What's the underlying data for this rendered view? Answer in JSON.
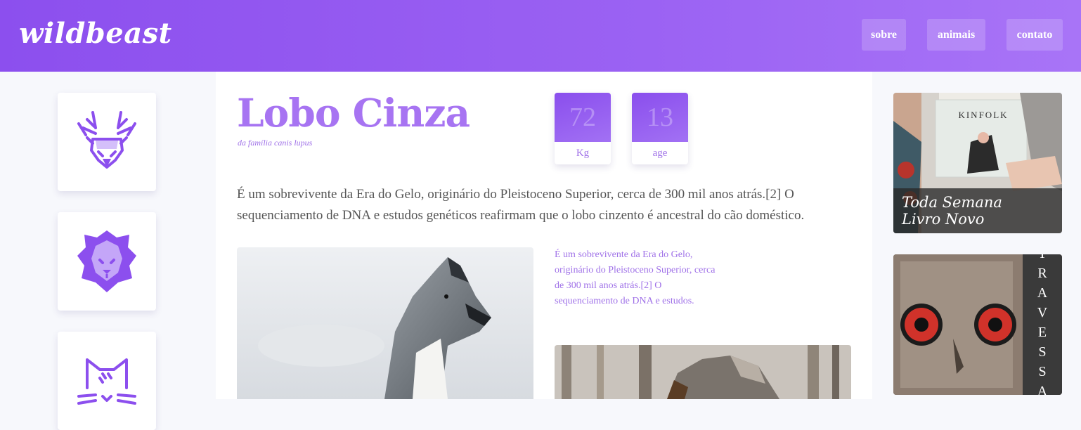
{
  "header": {
    "logo": "wildbeast",
    "nav": [
      {
        "label": "sobre"
      },
      {
        "label": "animais"
      },
      {
        "label": "contato"
      }
    ]
  },
  "sidebar": {
    "animals": [
      {
        "icon": "deer-icon"
      },
      {
        "icon": "lion-icon"
      },
      {
        "icon": "cat-icon"
      }
    ]
  },
  "main": {
    "title": "Lobo Cinza",
    "subtitle": "da família canis lupus",
    "stats": [
      {
        "value": "72",
        "label": "Kg"
      },
      {
        "value": "13",
        "label": "age"
      }
    ],
    "lead": "É um sobrevivente da Era do Gelo, originário do Pleistoceno Superior, cerca de 300 mil anos atrás.[2] O sequenciamento de DNA e estudos genéticos reafirmam que o lobo cinzento é ancestral do cão doméstico.",
    "side_text": "É um sobrevivente da Era do Gelo, originário do Pleistoceno Superior, cerca de 300 mil anos atrás.[2] O sequenciamento de DNA e estudos."
  },
  "ads": [
    {
      "brand_text": "KINFOLK",
      "caption_line1": "Toda Semana",
      "caption_line2": "Livro Novo"
    },
    {
      "vertical_text": "TRAVESSA"
    }
  ],
  "colors": {
    "accent": "#8c4fee",
    "accent_light": "#a774f2",
    "text": "#555555"
  }
}
